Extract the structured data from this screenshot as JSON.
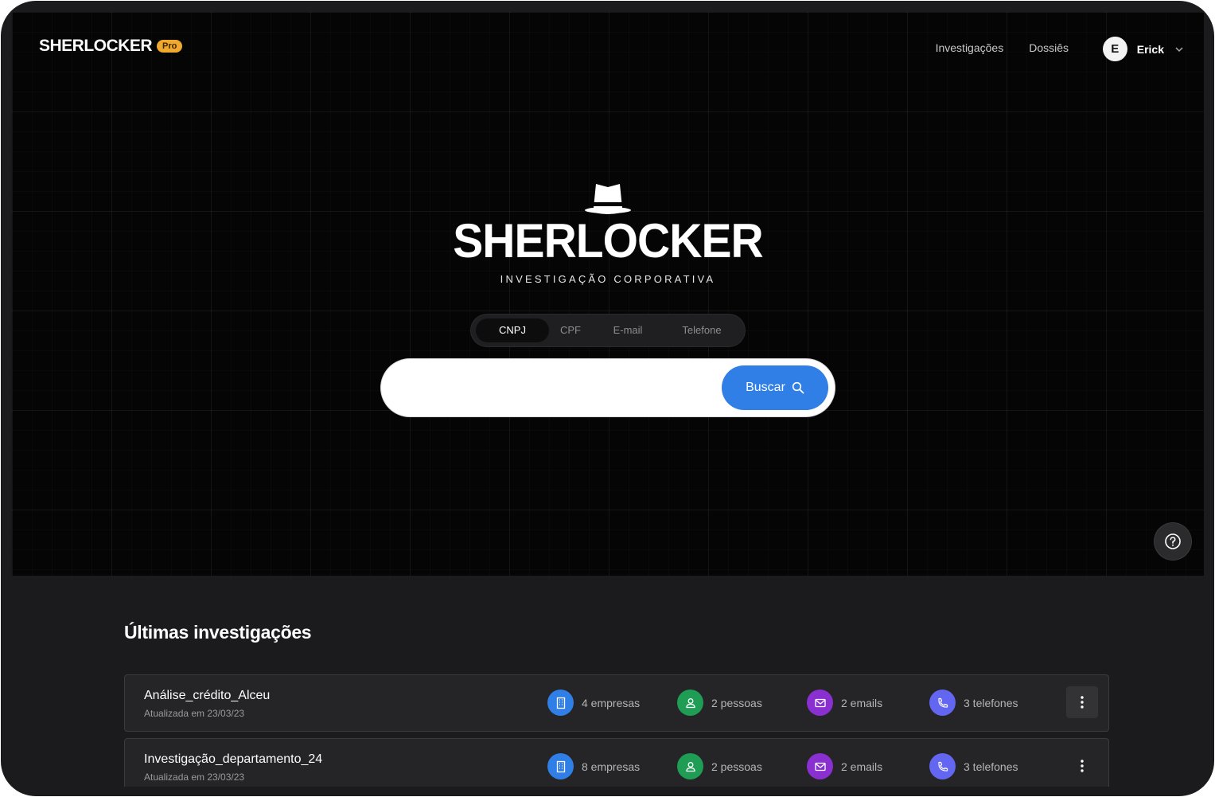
{
  "header": {
    "brand": "SHERLOCKER",
    "badge": "Pro",
    "nav": [
      "Investigações",
      "Dossiês"
    ],
    "user": {
      "initial": "E",
      "name": "Erick"
    }
  },
  "hero": {
    "logo_text": "SHERLOCKER",
    "logo_sub": "INVESTIGAÇÃO CORPORATIVA",
    "tabs": [
      "CNPJ",
      "CPF",
      "E-mail",
      "Telefone"
    ],
    "active_tab": "CNPJ",
    "search": {
      "value": "",
      "placeholder": "",
      "button_label": "Buscar"
    }
  },
  "recent": {
    "title": "Últimas investigações",
    "items": [
      {
        "name": "Análise_crédito_Alceu",
        "updated": "Atualizada em 23/03/23",
        "empresas": "4 empresas",
        "pessoas": "2 pessoas",
        "emails": "2 emails",
        "telefones": "3 telefones"
      },
      {
        "name": "Investigação_departamento_24",
        "updated": "Atualizada em 23/03/23",
        "empresas": "8 empresas",
        "pessoas": "2 pessoas",
        "emails": "2 emails",
        "telefones": "3 telefones"
      }
    ]
  },
  "icons": {
    "empresas": "building-icon",
    "pessoas": "person-icon",
    "emails": "mail-icon",
    "telefones": "phone-icon",
    "help": "question-circle-icon",
    "more": "more-vertical-icon",
    "search": "search-icon",
    "chevron": "chevron-down-icon",
    "hat": "hat-icon"
  },
  "colors": {
    "accent": "#2f7fe6",
    "badge": "#f0a92c",
    "empresas": "#2f7fe6",
    "pessoas": "#1f9d55",
    "emails": "#8a2fd0",
    "telefones": "#6366f1"
  }
}
